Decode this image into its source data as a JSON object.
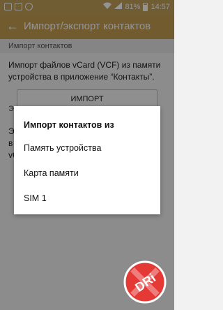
{
  "status_bar": {
    "battery": "81%",
    "time": "14:57"
  },
  "appbar": {
    "back_icon": "arrow-left-icon",
    "title": "Импорт/экспорт контактов"
  },
  "content": {
    "section_import": "Импорт контактов",
    "import_description": "Импорт файлов vCard (VCF) из памяти устройства в приложение “Контакты”.",
    "import_button": "ИМПОРТ",
    "section_export_partial": "Эк",
    "export_description_partial": "Эк\nв\nvC"
  },
  "dialog": {
    "title": "Импорт контактов из",
    "options": [
      "Память устройства",
      "Карта памяти",
      "SIM 1"
    ]
  },
  "watermark": {
    "text": "DRi",
    "color": "#e53935"
  }
}
